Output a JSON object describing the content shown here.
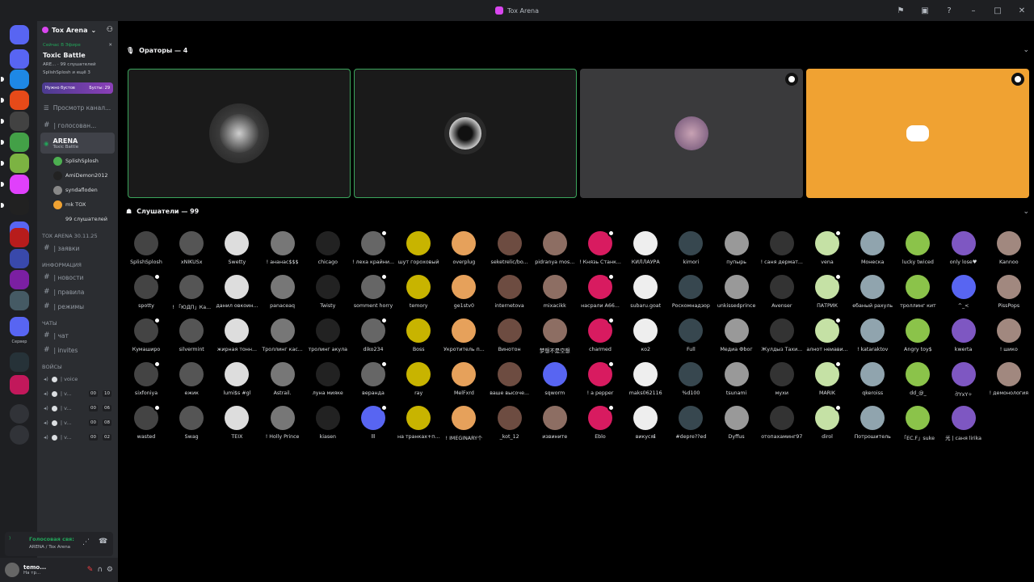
{
  "window": {
    "title": "Tox Arena"
  },
  "server": {
    "name": "Tox Arena"
  },
  "live_event": {
    "status": "Сейчас В Эфире",
    "title": "Toxic Battle",
    "listeners_line": "ARE... · 99 слушателей",
    "speakers_line": "SplishSplosh и ещё 3"
  },
  "boost": {
    "left": "Нужно бустов",
    "right": "Бусты: 29"
  },
  "browse_channels": "Просмотр канал...",
  "channels_top": [
    "| голосован..."
  ],
  "active_stage": {
    "name": "ARENA",
    "topic": "Toxic Battle"
  },
  "stage_members": [
    "SplishSplosh",
    "AmiDemon2012",
    "syndafloden",
    "mk TOX",
    "99 слушателей"
  ],
  "categories": [
    {
      "name": "TOX ARENA 30.11.25",
      "channels": [
        "| заявки"
      ]
    },
    {
      "name": "ИНФОРМАЦИЯ",
      "channels": [
        "| новости",
        "| правила",
        "| режимы"
      ]
    },
    {
      "name": "ЧАТЫ",
      "channels": [
        "| чат",
        "| invites"
      ]
    }
  ],
  "voices_category": "ВОЙСЫ",
  "voices": [
    {
      "name": "| voice",
      "t1": "",
      "t2": ""
    },
    {
      "name": "| v...",
      "t1": "00",
      "t2": "10"
    },
    {
      "name": "| v...",
      "t1": "00",
      "t2": "06"
    },
    {
      "name": "| v...",
      "t1": "00",
      "t2": "08"
    },
    {
      "name": "| v...",
      "t1": "00",
      "t2": "02"
    }
  ],
  "voice_status": {
    "title": "Голосовая свя:",
    "location": "ARENA / Tox Arena"
  },
  "user": {
    "name": "temo...",
    "status": "На тр..."
  },
  "guild_label": "Сервер",
  "speakers_header": "Ораторы — 4",
  "listeners_header": "Слушатели — 99",
  "listeners": [
    "SplishSplosh",
    "xNIKUSx",
    "Swetty",
    "! ананас$$$",
    "chicago",
    "! леха крайни...",
    "шут гороховый",
    "overplug",
    "seketrelic/bo...",
    "pidranya mos...",
    "! Князь Станк...",
    "КИЛЛАУРА",
    "kimori",
    "пупырь",
    "! саня дермат...",
    "vena",
    "Монеска",
    "lucky twiced",
    "only lose♥",
    "Kannoo",
    "spotty",
    "! 「ЮДП」Ка...",
    "данил овкоин...",
    "panaceaq",
    "Twisty",
    "somment horry",
    "temory",
    "ge1stv0",
    "internetova",
    "mixacikk",
    "насрали А66...",
    "subaru.goat",
    "Роскомнадзор",
    "unkissedprince",
    "Avenser",
    "ПАТРИК",
    "ебаный рахуль",
    "троллинг кит",
    "^_<",
    "PissPops",
    "Кумаширо",
    "silvermint",
    "жирная тонн...",
    "Троллинг кас...",
    "тролинг акула",
    "diko234",
    "Boss",
    "Укротитель п...",
    "Винотон",
    "梦想不是空想",
    "charmed",
    "ко2",
    "Full",
    "Медиа Фbог",
    "Жулдыз Тахи...",
    "алнот неиави...",
    "! kataraktov",
    "Angry toy$",
    "kwerta",
    "! шико",
    "sixfoniya",
    "ежик",
    "lumi$s #gl",
    "Astrail.",
    "луна мияке",
    "веранда",
    "ray",
    "MelFxrd",
    "ваше высоче...",
    "sqworm",
    "! a pepper",
    "maks062116",
    "%d100",
    "tsunami",
    "мухи",
    "MARIK",
    "qkeroiss",
    "dd_@_",
    "ঔYxY✧",
    "! демонология",
    "wasted",
    "Swag",
    "TEIX",
    "! Holly Prince",
    "kiasen",
    "lll",
    "на транках+п...",
    "! IMEGINARY个",
    "_kot_12",
    "извините",
    "Eblo",
    "викусяℹ",
    "#depre??ed",
    "Dyffus",
    "отопахаминг97",
    "dirol",
    "Потрошитель",
    "「EC.F」suke",
    "光 | саня lirika"
  ],
  "colors": {
    "live": "#23a55a",
    "speaking": "#3ba55c",
    "discord_orange": "#f0a232",
    "blurple": "#5865f2"
  }
}
